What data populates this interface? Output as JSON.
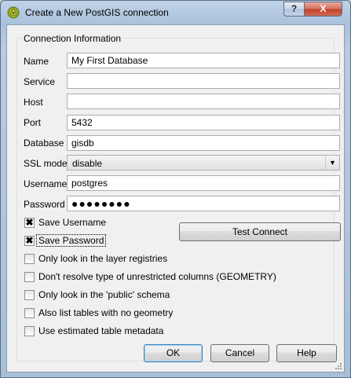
{
  "window": {
    "title": "Create a New PostGIS connection",
    "help_glyph": "?",
    "close_glyph": "X"
  },
  "group": {
    "title": "Connection Information"
  },
  "fields": {
    "name": {
      "label": "Name",
      "value": "My First Database"
    },
    "service": {
      "label": "Service",
      "value": ""
    },
    "host": {
      "label": "Host",
      "value": ""
    },
    "port": {
      "label": "Port",
      "value": "5432"
    },
    "database": {
      "label": "Database",
      "value": "gisdb"
    },
    "ssl_mode": {
      "label": "SSL mode",
      "value": "disable"
    },
    "username": {
      "label": "Username",
      "value": "postgres"
    },
    "password": {
      "label": "Password",
      "value": "●●●●●●●●"
    }
  },
  "checkboxes": {
    "save_username": {
      "label": "Save Username",
      "checked": true
    },
    "save_password": {
      "label": "Save Password",
      "checked": true
    },
    "only_registries": {
      "label": "Only look in the layer registries",
      "checked": false
    },
    "dont_resolve": {
      "label": "Don't resolve type of unrestricted columns (GEOMETRY)",
      "checked": false
    },
    "public_schema": {
      "label": "Only look in the 'public' schema",
      "checked": false
    },
    "no_geometry": {
      "label": "Also list tables with no geometry",
      "checked": false
    },
    "estimated_metadata": {
      "label": "Use estimated table metadata",
      "checked": false
    }
  },
  "check_glyph": "✖",
  "buttons": {
    "test_connect": "Test Connect",
    "ok": "OK",
    "cancel": "Cancel",
    "help": "Help"
  },
  "icons": {
    "app": "qgis-logo-icon",
    "dropdown": "chevron-down-icon",
    "grip": "resize-grip-icon"
  },
  "colors": {
    "title_gradient_top": "#bfd3e8",
    "close_button": "#c2402a",
    "dialog_bg": "#f0f0f0"
  }
}
